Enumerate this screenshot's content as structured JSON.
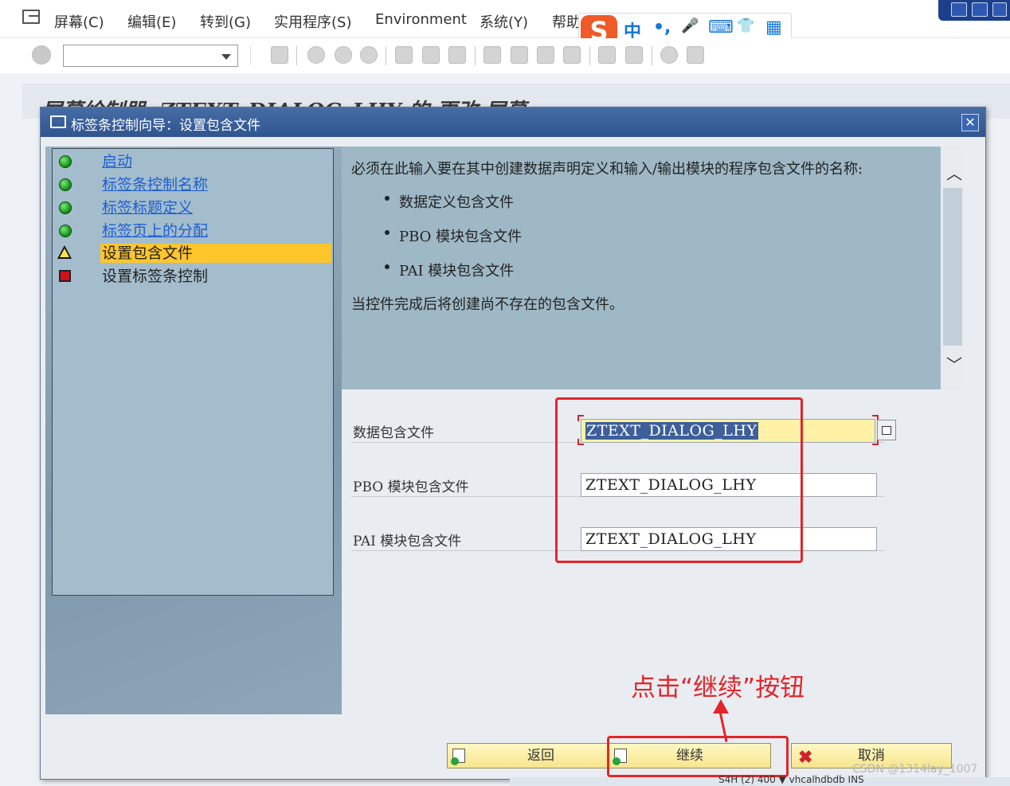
{
  "menu": {
    "items": [
      "屏幕(C)",
      "编辑(E)",
      "转到(G)",
      "实用程序(S)",
      "Environment",
      "系统(Y)",
      "帮助"
    ]
  },
  "ime": {
    "logo": "S",
    "symbols": [
      "中",
      "•,",
      "🎤",
      "⌨",
      "👕",
      "▦"
    ]
  },
  "background_screen": {
    "title": "屏幕绘制器: ZTEXT_DIALOG_LHY 的 更改 屏幕"
  },
  "dialog": {
    "title": "标签条控制向导：设置包含文件",
    "close_glyph": "✕",
    "steps": [
      {
        "label": "启动",
        "state": "done"
      },
      {
        "label": "标签条控制名称",
        "state": "done"
      },
      {
        "label": "标签标题定义",
        "state": "done"
      },
      {
        "label": "标签页上的分配",
        "state": "done"
      },
      {
        "label": "设置包含文件",
        "state": "current"
      },
      {
        "label": "设置标签条控制",
        "state": "pending"
      }
    ],
    "info": {
      "intro": "必须在此输入要在其中创建数据声明定义和输入/输出模块的程序包含文件的名称:",
      "bullets": [
        "数据定义包含文件",
        "PBO 模块包含文件",
        "PAI 模块包含文件"
      ],
      "note": "当控件完成后将创建尚不存在的包含文件。"
    },
    "fields": [
      {
        "label": "数据包含文件",
        "value": "ZTEXT_DIALOG_LHY"
      },
      {
        "label": "PBO 模块包含文件",
        "value": "ZTEXT_DIALOG_LHY"
      },
      {
        "label": "PAI 模块包含文件",
        "value": "ZTEXT_DIALOG_LHY"
      }
    ],
    "buttons": {
      "back": "返回",
      "continue": "继续",
      "cancel": "取消"
    }
  },
  "annotation": {
    "text": "点击“继续”按钮",
    "color": "#e1262a"
  },
  "status_bar": {
    "text": "S4H (2) 400 ▼   vhcalhdbdb   INS"
  },
  "watermark": "CSDN @1314lay_1007",
  "colors": {
    "dialog_title_bar": "#2f5490",
    "current_step_highlight": "#ffc62b",
    "highlighted_field": "#fff2a6",
    "footer_button": "#f7e58c"
  }
}
